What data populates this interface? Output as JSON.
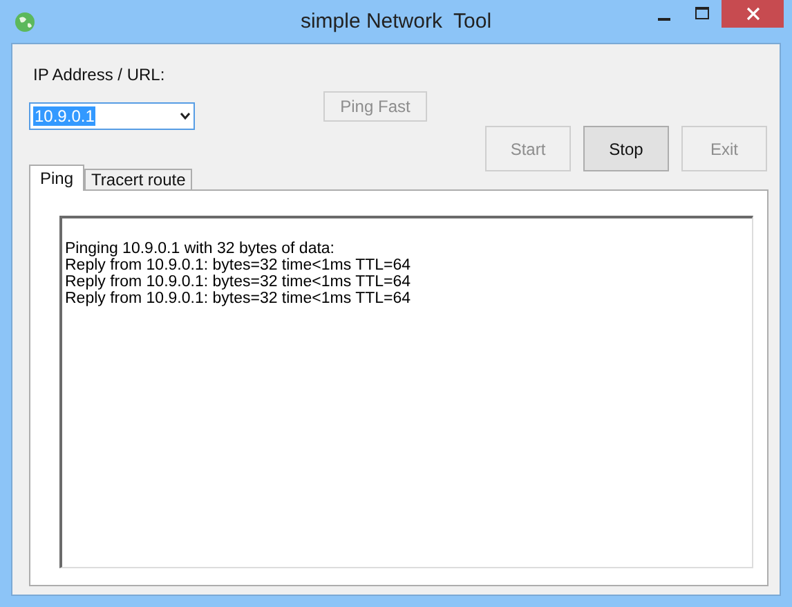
{
  "window": {
    "title": "simple Network  Tool"
  },
  "address": {
    "label": "IP Address / URL:",
    "value": "10.9.0.1"
  },
  "buttons": [
    {
      "label": "Ping  Fast",
      "disabled": true
    },
    {
      "label": "Start",
      "disabled": true
    },
    {
      "label": "Stop",
      "disabled": false
    },
    {
      "label": "Exit",
      "disabled": true
    }
  ],
  "tabs": [
    {
      "label": "Ping",
      "selected": true
    },
    {
      "label": "Tracert route",
      "selected": false
    }
  ],
  "output": {
    "lines": [
      "Pinging 10.9.0.1 with 32 bytes of data:",
      "Reply from 10.9.0.1: bytes=32 time<1ms TTL=64",
      "Reply from 10.9.0.1: bytes=32 time<1ms TTL=64",
      "Reply from 10.9.0.1: bytes=32 time<1ms TTL=64"
    ]
  }
}
